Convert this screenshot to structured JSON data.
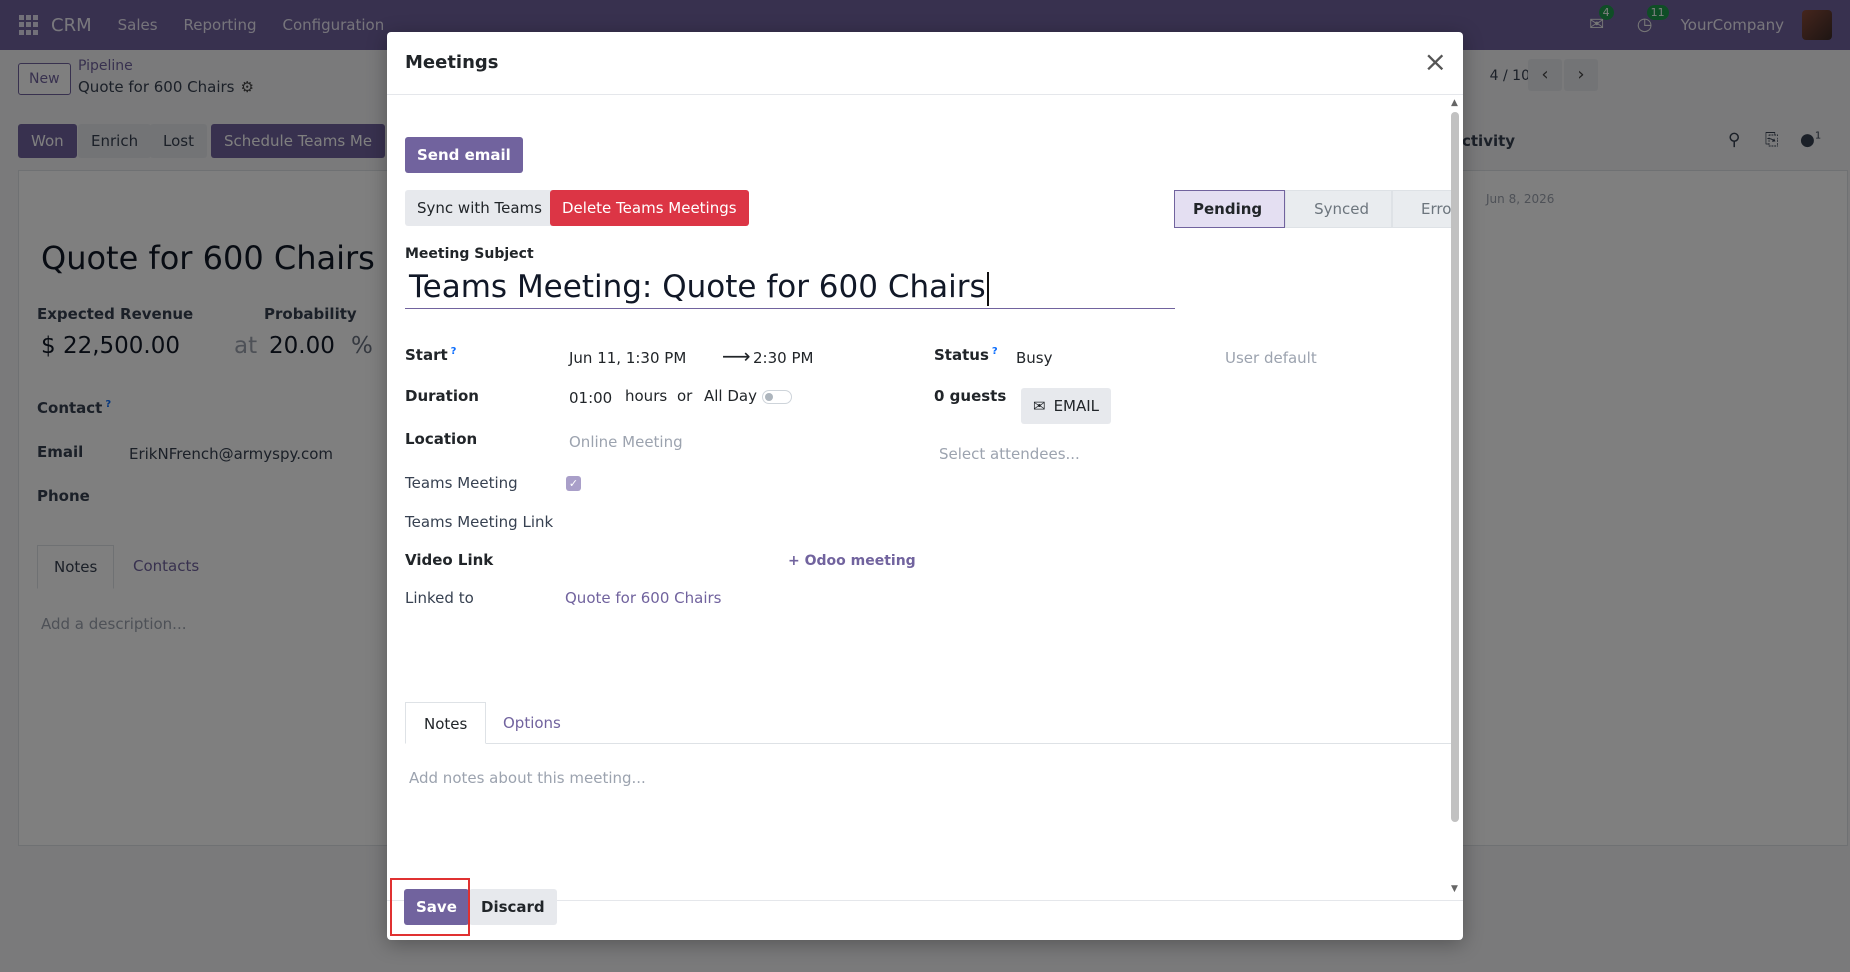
{
  "navbar": {
    "brand": "CRM",
    "menu": [
      "Sales",
      "Reporting",
      "Configuration"
    ],
    "messages_badge": "4",
    "activities_badge": "11",
    "company": "YourCompany"
  },
  "control_panel": {
    "new_label": "New",
    "breadcrumb": "Pipeline",
    "record_name": "Quote for 600 Chairs",
    "pager": "4 / 10"
  },
  "statusbar_buttons": [
    "Won",
    "Enrich",
    "Lost",
    "Schedule Teams Me"
  ],
  "record": {
    "title": "Quote for 600 Chairs",
    "expected_revenue_label": "Expected Revenue",
    "expected_revenue": "$ 22,500.00",
    "probability_label": "Probability",
    "at": "at",
    "probability": "20.00",
    "percent": "%",
    "contact_label": "Contact",
    "email_label": "Email",
    "email": "ErikNFrench@armyspy.com",
    "phone_label": "Phone",
    "tabs": [
      "Notes",
      "Contacts"
    ],
    "description_placeholder": "Add a description...",
    "chatter_activity": "ctivity",
    "chatter_date": "Jun 8, 2026",
    "followers": "1"
  },
  "modal": {
    "title": "Meetings",
    "send_email": "Send email",
    "sync_teams": "Sync with Teams",
    "delete_teams": "Delete Teams Meetings",
    "stages": [
      "Pending",
      "Synced",
      "Error"
    ],
    "subject_label": "Meeting Subject",
    "subject": "Teams Meeting: Quote for 600 Chairs",
    "start_label": "Start",
    "start": "Jun 11, 1:30 PM",
    "end": "2:30 PM",
    "duration_label": "Duration",
    "duration": "01:00",
    "hours": "hours",
    "or": "or",
    "all_day": "All Day",
    "location_label": "Location",
    "location_placeholder": "Online Meeting",
    "teams_meeting_label": "Teams Meeting",
    "teams_link_label": "Teams Meeting Link",
    "video_link_label": "Video Link",
    "odoo_meeting": "Odoo meeting",
    "linked_to_label": "Linked to",
    "linked_to": "Quote for 600 Chairs",
    "status_label": "Status",
    "status": "Busy",
    "user_default": "User default",
    "guests": "0 guests",
    "email_btn": "EMAIL",
    "attendees_placeholder": "Select attendees...",
    "tabs": [
      "Notes",
      "Options"
    ],
    "notes_placeholder": "Add notes about this meeting...",
    "save": "Save",
    "discard": "Discard"
  }
}
